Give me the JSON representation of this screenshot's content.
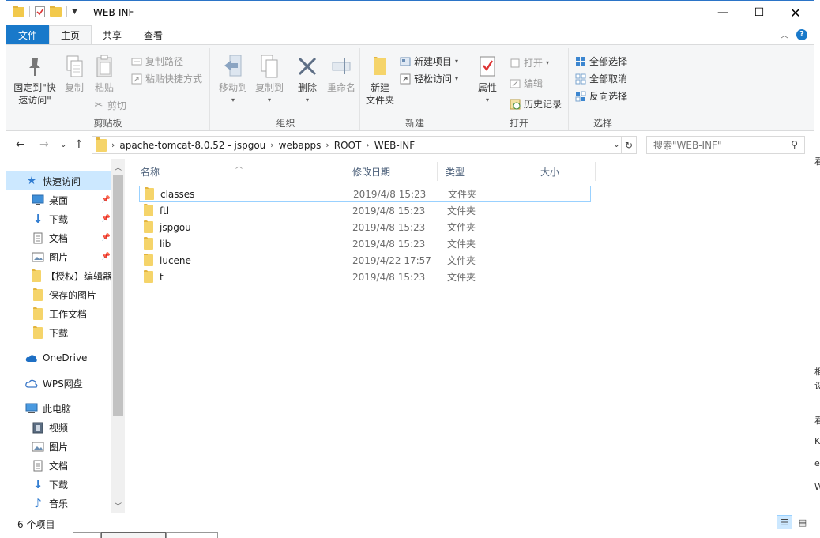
{
  "window": {
    "title": "WEB-INF",
    "controls": {
      "minimize": "—",
      "maximize": "☐",
      "close": "✕"
    }
  },
  "ribbon_tabs": [
    "文件",
    "主页",
    "共享",
    "查看"
  ],
  "ribbon": {
    "clipboard": {
      "label": "剪贴板",
      "pin_label_1": "固定到\"快",
      "pin_label_2": "速访问\"",
      "copy": "复制",
      "paste": "粘贴",
      "copy_path": "复制路径",
      "paste_shortcut": "粘贴快捷方式",
      "cut": "剪切"
    },
    "organize": {
      "label": "组织",
      "move_to": "移动到",
      "copy_to": "复制到",
      "delete": "删除",
      "rename": "重命名"
    },
    "new": {
      "label": "新建",
      "new_folder_1": "新建",
      "new_folder_2": "文件夹",
      "new_item": "新建项目",
      "easy_access": "轻松访问"
    },
    "open": {
      "label": "打开",
      "properties": "属性",
      "open": "打开",
      "edit": "编辑",
      "history": "历史记录"
    },
    "select": {
      "label": "选择",
      "select_all": "全部选择",
      "select_none": "全部取消",
      "invert": "反向选择"
    }
  },
  "address": {
    "crumbs": [
      "apache-tomcat-8.0.52 - jspgou",
      "webapps",
      "ROOT",
      "WEB-INF"
    ],
    "search_placeholder": "搜索\"WEB-INF\""
  },
  "nav_pane": {
    "quick_access": "快速访问",
    "quick_items": [
      "桌面",
      "下载",
      "文档",
      "图片",
      "【授权】编辑器",
      "保存的图片",
      "工作文档",
      "下载"
    ],
    "onedrive": "OneDrive",
    "wps": "WPS网盘",
    "this_pc": "此电脑",
    "pc_items": [
      "视频",
      "图片",
      "文档",
      "下载",
      "音乐"
    ]
  },
  "columns": {
    "name": "名称",
    "modified": "修改日期",
    "type": "类型",
    "size": "大小"
  },
  "files": [
    {
      "name": "classes",
      "modified": "2019/4/8 15:23",
      "type": "文件夹"
    },
    {
      "name": "ftl",
      "modified": "2019/4/8 15:23",
      "type": "文件夹"
    },
    {
      "name": "jspgou",
      "modified": "2019/4/8 15:23",
      "type": "文件夹"
    },
    {
      "name": "lib",
      "modified": "2019/4/8 15:23",
      "type": "文件夹"
    },
    {
      "name": "lucene",
      "modified": "2019/4/22 17:57",
      "type": "文件夹"
    },
    {
      "name": "t",
      "modified": "2019/4/8 15:23",
      "type": "文件夹"
    }
  ],
  "status": {
    "item_count": "6 个项目"
  },
  "colors": {
    "accent": "#1979ca",
    "selection": "#cce8ff",
    "folder": "#f2c94c"
  }
}
